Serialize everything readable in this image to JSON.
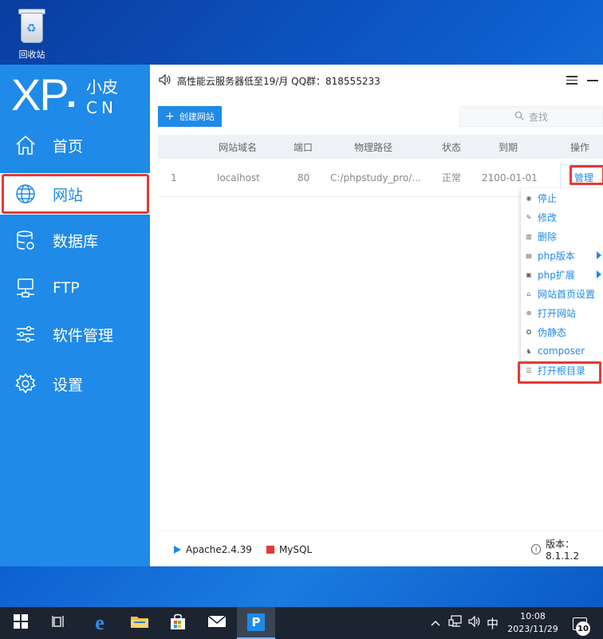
{
  "desktop": {
    "recycle_bin_label": "回收站"
  },
  "logo": {
    "main": "XP",
    "top": "小皮",
    "bottom": "CN"
  },
  "sidebar": {
    "items": [
      {
        "label": "首页",
        "icon": "home-icon"
      },
      {
        "label": "网站",
        "icon": "globe-icon",
        "active": true
      },
      {
        "label": "数据库",
        "icon": "database-icon"
      },
      {
        "label": "FTP",
        "icon": "ftp-icon"
      },
      {
        "label": "软件管理",
        "icon": "sliders-icon"
      },
      {
        "label": "设置",
        "icon": "gear-icon"
      }
    ]
  },
  "topbar": {
    "announcement": "高性能云服务器低至19/月  QQ群：818555233"
  },
  "toolbar": {
    "create_label": "创建网站",
    "search_placeholder": "查找"
  },
  "table": {
    "headers": [
      "网站域名",
      "端口",
      "物理路径",
      "状态",
      "到期",
      "操作"
    ],
    "rows": [
      {
        "index": "1",
        "domain": "localhost",
        "port": "80",
        "path": "C:/phpstudy_pro/...",
        "status": "正常",
        "expires": "2100-01-01",
        "action": "管理"
      }
    ]
  },
  "context_menu": {
    "items": [
      {
        "label": "停止",
        "icon": "stop-icon"
      },
      {
        "label": "修改",
        "icon": "pencil-icon"
      },
      {
        "label": "删除",
        "icon": "trash-icon"
      },
      {
        "label": "php版本",
        "icon": "php-version-icon",
        "submenu": true
      },
      {
        "label": "php扩展",
        "icon": "php-extension-icon",
        "submenu": true
      },
      {
        "label": "网站首页设置",
        "icon": "homepage-icon"
      },
      {
        "label": "打开网站",
        "icon": "open-site-icon"
      },
      {
        "label": "伪静态",
        "icon": "rewrite-icon"
      },
      {
        "label": "composer",
        "icon": "composer-icon"
      },
      {
        "label": "打开根目录",
        "icon": "folder-list-icon"
      }
    ]
  },
  "status_bar": {
    "apache": "Apache2.4.39",
    "mysql": "MySQL",
    "version": "版本：8.1.1.2"
  },
  "taskbar": {
    "ime": "中",
    "time": "10:08",
    "date": "2023/11/29",
    "notifications": "10"
  },
  "colors": {
    "accent": "#1f8ae8",
    "highlight": "#e53935",
    "taskbar": "#1b2430"
  }
}
